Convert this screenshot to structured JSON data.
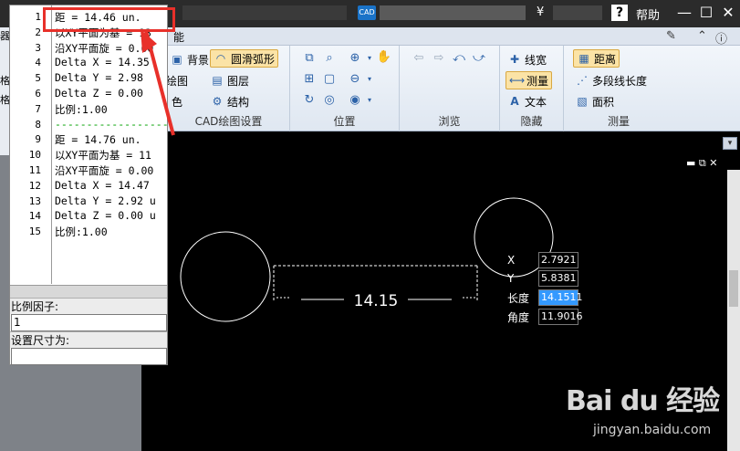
{
  "titlebar": {
    "cad_badge": "CAD",
    "yen": "¥",
    "help_icon": "?",
    "help_label": "帮助",
    "minimize": "—",
    "maximize": "☐",
    "close": "✕"
  },
  "ribbon_top": {
    "tab_label": "能"
  },
  "ribbon": {
    "group_cad": {
      "label": "CAD绘图设置",
      "btn_background": "背景",
      "btn_smooth_arc": "圆滑弧形",
      "btn_drawing": "绘图",
      "btn_layer": "图层",
      "btn_color": "色",
      "btn_structure": "结构"
    },
    "group_position": {
      "label": "位置"
    },
    "group_browse": {
      "label": "浏览"
    },
    "group_hide": {
      "label": "隐藏",
      "btn_linewidth": "线宽",
      "btn_measure": "测量",
      "btn_text": "文本"
    },
    "group_measure": {
      "label": "测量",
      "btn_distance": "距离",
      "btn_polyline_length": "多段线长度",
      "btn_area": "面积"
    }
  },
  "left_strip": [
    "器",
    "格",
    "格"
  ],
  "popup": {
    "lines": [
      {
        "n": "1",
        "text": "距 = 14.46 un."
      },
      {
        "n": "2",
        "text": "以XY平面为基 = 13"
      },
      {
        "n": "3",
        "text": "沿XY平面旋 = 0.00"
      },
      {
        "n": "4",
        "text": "Delta X = 14.35"
      },
      {
        "n": "5",
        "text": "Delta Y = 2.98"
      },
      {
        "n": "6",
        "text": "Delta Z = 0.00"
      },
      {
        "n": "7",
        "text": "比例:1.00"
      },
      {
        "n": "8",
        "text": "------------------"
      },
      {
        "n": "9",
        "text": "距 = 14.76 un."
      },
      {
        "n": "10",
        "text": "以XY平面为基 = 11"
      },
      {
        "n": "11",
        "text": "沿XY平面旋 = 0.00"
      },
      {
        "n": "12",
        "text": "Delta X = 14.47"
      },
      {
        "n": "13",
        "text": "Delta Y = 2.92 u"
      },
      {
        "n": "14",
        "text": "Delta Z = 0.00 u"
      },
      {
        "n": "15",
        "text": "比例:1.00"
      }
    ],
    "scale_label": "比例因子:",
    "scale_value": "1",
    "dim_label": "设置尺寸为:",
    "dim_value": ""
  },
  "canvas": {
    "dimension_text": "14.15",
    "info": {
      "x_label": "X",
      "x_value": "2.7921",
      "y_label": "Y",
      "y_value": "5.8381",
      "len_label": "长度",
      "len_value": "14.1511",
      "angle_label": "角度",
      "angle_value": "11.9016"
    },
    "tools": "▬ ⧉ ✕"
  },
  "watermark": {
    "logo": "Bai du 经验",
    "url": "jingyan.baidu.com"
  },
  "colors": {
    "highlight": "#e8302a",
    "selection": "#3399ff",
    "canvas_bg": "#000000"
  }
}
